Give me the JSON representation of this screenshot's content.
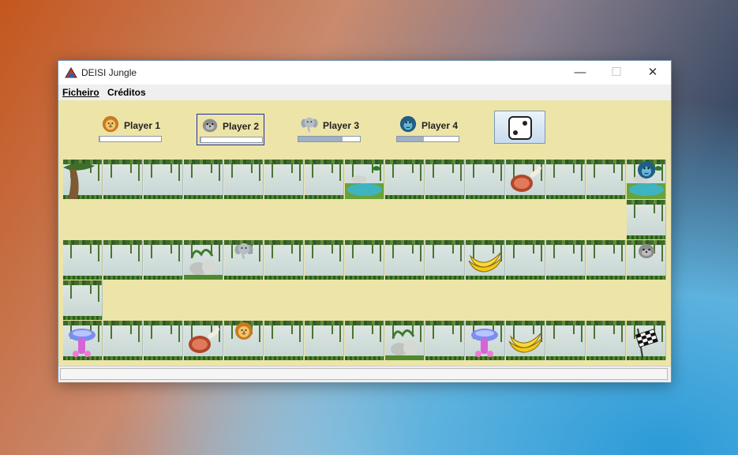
{
  "window": {
    "title": "DEISI Jungle"
  },
  "menu": {
    "items": [
      "Ficheiro",
      "Créditos"
    ]
  },
  "players": [
    {
      "name": "Player 1",
      "animal": "lion-icon",
      "energy_pct": 1
    },
    {
      "name": "Player 2",
      "animal": "seal-icon",
      "energy_pct": 1,
      "selected": true
    },
    {
      "name": "Player 3",
      "animal": "elephant-icon",
      "energy_pct": 72
    },
    {
      "name": "Player 4",
      "animal": "monkey-icon",
      "energy_pct": 44
    }
  ],
  "dice": {
    "icon": "dice-icon",
    "face": 2
  },
  "board": {
    "rows": [
      {
        "cells": [
          "tree",
          "plain",
          "plain",
          "plain",
          "plain",
          "plain",
          "plain",
          "lake",
          "plain",
          "plain",
          "plain",
          "meat",
          "plain",
          "plain",
          "lake"
        ]
      },
      {
        "cells": [
          "",
          "",
          "",
          "",
          "",
          "",
          "",
          "",
          "",
          "",
          "",
          "",
          "",
          "",
          "plain"
        ]
      },
      {
        "cells": [
          "plain",
          "plain",
          "plain",
          "rocks",
          "plain",
          "plain",
          "plain",
          "plain",
          "plain",
          "plain",
          "banana",
          "plain",
          "plain",
          "plain",
          "plain"
        ]
      },
      {
        "cells": [
          "plain"
        ]
      },
      {
        "cells": [
          "mushroom",
          "plain",
          "plain",
          "meat",
          "plain",
          "plain",
          "plain",
          "plain",
          "rocks",
          "plain",
          "mushroom",
          "banana",
          "plain",
          "plain",
          "finish"
        ]
      }
    ],
    "pawns": [
      {
        "player": "Player 4",
        "animal": "monkey-icon",
        "row": 0,
        "col": 14
      },
      {
        "player": "Player 3",
        "animal": "elephant-icon",
        "row": 2,
        "col": 4
      },
      {
        "player": "Player 2",
        "animal": "seal-icon",
        "row": 2,
        "col": 14
      },
      {
        "player": "Player 1",
        "animal": "lion-icon",
        "row": 4,
        "col": 4
      }
    ]
  },
  "colors": {
    "panel": "#ede4a8",
    "accent": "#1f2fa8",
    "energy": "#9fb1c7"
  }
}
